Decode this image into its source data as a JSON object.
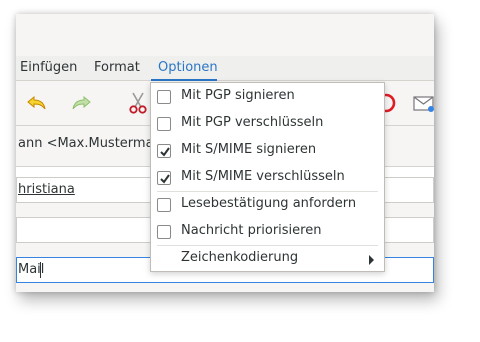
{
  "menubar": {
    "items": [
      {
        "label": "Einfügen",
        "active": false
      },
      {
        "label": "Format",
        "active": false
      },
      {
        "label": "Optionen",
        "active": true
      }
    ]
  },
  "toolbar": {
    "icons": [
      "undo-icon",
      "redo-icon",
      "cut-icon",
      "stop-icon",
      "envelope-icon"
    ],
    "colors": {
      "undo": "#e5a50a",
      "redo": "#a9d18e",
      "cut": "#c01c28",
      "stop": "#e01b24"
    }
  },
  "compose": {
    "from_value": "ann <Max.Musterma",
    "to_value": "hristiana",
    "empty_value": "",
    "subject_value": "Mail"
  },
  "options_menu": {
    "items": [
      {
        "label": "Mit PGP signieren",
        "checked": false
      },
      {
        "label": "Mit PGP verschlüsseln",
        "checked": false
      },
      {
        "label": "Mit S/MIME signieren",
        "checked": true
      },
      {
        "label": "Mit S/MIME verschlüsseln",
        "checked": true
      },
      {
        "label": "Lesebestätigung anfordern",
        "checked": false
      },
      {
        "label": "Nachricht priorisieren",
        "checked": false
      },
      {
        "label": "Zeichenkodierung",
        "submenu": true
      }
    ]
  },
  "colors": {
    "accent": "#2a76c6",
    "focus": "#3584e4"
  }
}
